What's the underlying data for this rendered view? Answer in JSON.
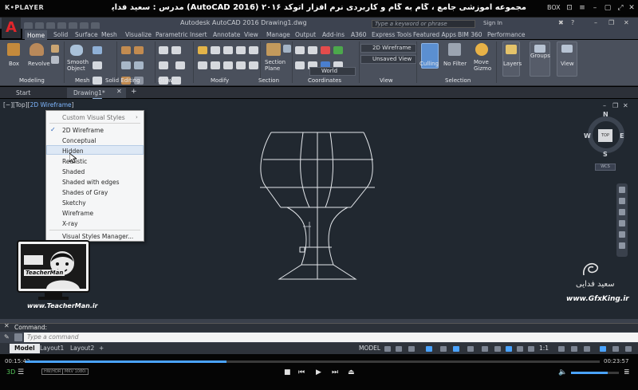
{
  "player": {
    "logo": "K•PLAYER",
    "title": "مجموعه آموزشی جامع ، گام به گام و کاربردی نرم افزار اتوکد ۲۰۱۶ (AutoCAD 2016) مدرس : سعید فدایی (تیچرمن) گروه آموزشی پادشاه گرافیست ها",
    "box_label": "BOX",
    "time_elapsed": "00:15:42",
    "time_total": "00:23:57",
    "progress_percent": 35,
    "badge_1": "HW/HDR",
    "badge_2": "MKV 1080i"
  },
  "acad": {
    "title": "Autodesk AutoCAD 2016    Drawing1.dwg",
    "search_placeholder": "Type a keyword or phrase",
    "sign_in": "Sign In",
    "tabs": [
      "Home",
      "Solid",
      "Surface",
      "Mesh",
      "Visualize",
      "Parametric",
      "Insert",
      "Annotate",
      "View",
      "Manage",
      "Output",
      "Add-ins",
      "A360",
      "Express Tools",
      "Featured Apps",
      "BIM 360",
      "Performance"
    ],
    "active_tab": "Home",
    "ribbon": {
      "box_label": "Box",
      "revolve_label": "Revolve",
      "smooth_label": "Smooth\nObject",
      "section_plane_label": "Section\nPlane",
      "culling_label": "Culling",
      "no_filter_label": "No Filter",
      "move_gizmo_label": "Move\nGizmo",
      "layers_label": "Layers",
      "groups_label": "Groups",
      "view_label": "View",
      "visual_style_value": "2D Wireframe",
      "view_value": "Unsaved View",
      "coord_value": "World",
      "panels": [
        "Modeling",
        "Mesh",
        "Solid Editing",
        "Draw",
        "Modify",
        "Section",
        "Coordinates",
        "View",
        "Selection"
      ]
    },
    "file_tabs": [
      "Start",
      "Drawing1*"
    ],
    "viewport_label_prefix": "[−][Top][",
    "viewport_label_style": "2D Wireframe",
    "viewport_label_suffix": "]",
    "context_menu": {
      "header": "Custom Visual Styles",
      "items": [
        "2D Wireframe",
        "Conceptual",
        "Hidden",
        "Realistic",
        "Shaded",
        "Shaded with edges",
        "Shades of Gray",
        "Sketchy",
        "Wireframe",
        "X-ray"
      ],
      "checked": "2D Wireframe",
      "hovered": "Hidden",
      "manager": "Visual Styles Manager..."
    },
    "viewcube": {
      "top": "TOP",
      "n": "N",
      "s": "S",
      "e": "E",
      "w": "W",
      "wcs": "WCS"
    },
    "command": {
      "history": "Command:",
      "placeholder": "Type a command"
    },
    "layout_tabs": [
      "Model",
      "Layout1",
      "Layout2",
      "+"
    ],
    "status": {
      "model": "MODEL",
      "scale": "1:1"
    }
  },
  "watermark": {
    "teacher_name": "TeacherMan",
    "teacher_url": "www.TeacherMan.ir",
    "gfx_url": "www.GfxKing.ir",
    "signature": "سعید فدایی"
  },
  "colors": {
    "drawing_bg": "#212830",
    "ribbon_bg": "#4a505c",
    "accent_blue": "#4aa3ff",
    "acad_red": "#e0262b"
  }
}
